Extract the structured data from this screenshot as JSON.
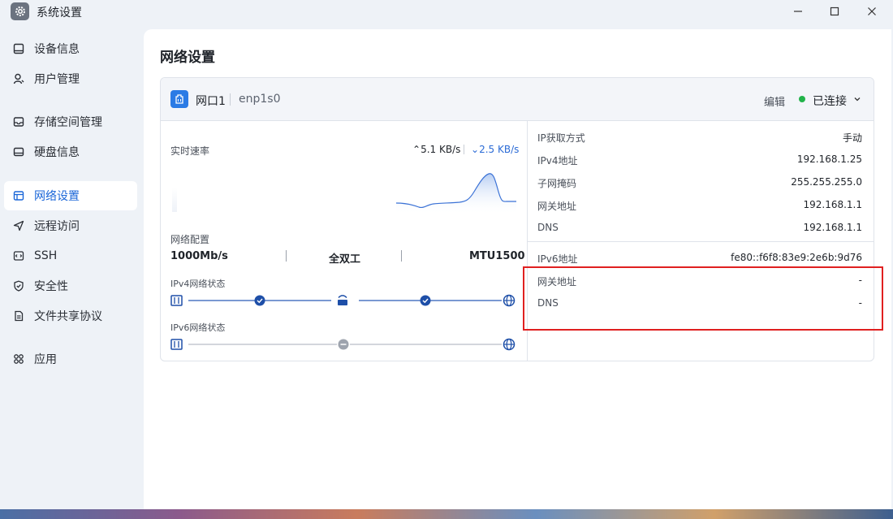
{
  "window": {
    "title": "系统设置",
    "icon": "gear-icon"
  },
  "sidebar": {
    "items": [
      {
        "label": "设备信息",
        "icon": "device-icon",
        "active": false
      },
      {
        "label": "用户管理",
        "icon": "user-icon",
        "active": false
      },
      {
        "label": "存储空间管理",
        "icon": "storage-icon",
        "active": false
      },
      {
        "label": "硬盘信息",
        "icon": "disk-icon",
        "active": false
      },
      {
        "label": "网络设置",
        "icon": "network-icon",
        "active": true
      },
      {
        "label": "远程访问",
        "icon": "send-icon",
        "active": false
      },
      {
        "label": "SSH",
        "icon": "code-icon",
        "active": false
      },
      {
        "label": "安全性",
        "icon": "shield-icon",
        "active": false
      },
      {
        "label": "文件共享协议",
        "icon": "file-icon",
        "active": false
      },
      {
        "label": "应用",
        "icon": "apps-icon",
        "active": false
      }
    ]
  },
  "main": {
    "title": "网络设置",
    "card": {
      "port_name": "网口1",
      "device": "enp1s0",
      "edit_label": "编辑",
      "status": "已连接",
      "status_color": "#22b34a",
      "realtime_label": "实时速率",
      "upload_speed": "5.1 KB/s",
      "download_speed": "2.5 KB/s",
      "config_label": "网络配置",
      "speed": "1000Mb/s",
      "duplex": "全双工",
      "mtu": "MTU1500",
      "ipv4_status_label": "IPv4网络状态",
      "ipv6_status_label": "IPv6网络状态",
      "ipv4_rows": [
        {
          "label": "IP获取方式",
          "value": "手动"
        },
        {
          "label": "IPv4地址",
          "value": "192.168.1.25"
        },
        {
          "label": "子网掩码",
          "value": "255.255.255.0"
        },
        {
          "label": "网关地址",
          "value": "192.168.1.1"
        },
        {
          "label": "DNS",
          "value": "192.168.1.1"
        }
      ],
      "ipv6_rows": [
        {
          "label": "IPv6地址",
          "value": "fe80::f6f8:83e9:2e6b:9d76"
        },
        {
          "label": "网关地址",
          "value": "-"
        },
        {
          "label": "DNS",
          "value": "-"
        }
      ]
    }
  },
  "colors": {
    "accent": "#1a66d8",
    "highlight": "#e02020"
  }
}
